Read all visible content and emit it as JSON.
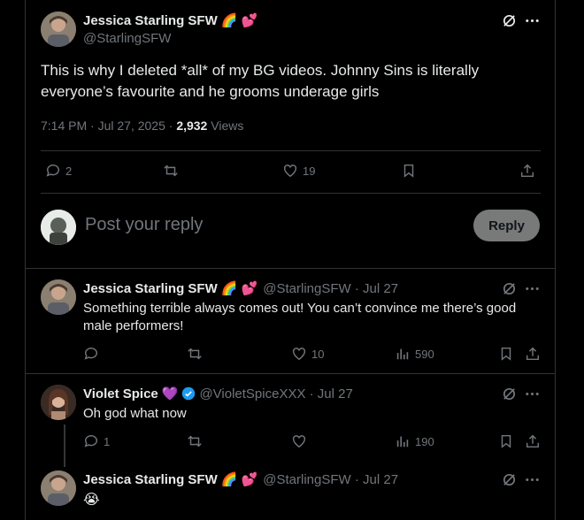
{
  "main_post": {
    "author_name": "Jessica Starling SFW",
    "author_emoji": "🌈 💕",
    "handle": "@StarlingSFW",
    "text_line1": "This is why I deleted *all* of my BG videos. Johnny Sins is literally",
    "text_line2": "everyone’s favourite and he grooms underage girls",
    "time": "7:14 PM · Jul 27, 2025 · ",
    "views_count": "2,932",
    "views_label": " Views",
    "replies": "2",
    "likes": "19"
  },
  "reply_box": {
    "placeholder": "Post your reply",
    "button_label": "Reply"
  },
  "replies": [
    {
      "author_name": "Jessica Starling SFW",
      "author_emoji": "🌈 💕",
      "handle_date": "@StarlingSFW · Jul 27",
      "text_line1": "Something terrible always comes out! You can’t convince me there’s good",
      "text_line2": "male performers!",
      "replies": "",
      "likes": "10",
      "views": "590"
    },
    {
      "author_name": "Violet Spice",
      "author_emoji": "💜",
      "handle_date": "@VioletSpiceXXX · Jul 27",
      "text_line1": "Oh god what now",
      "replies": "1",
      "likes": "",
      "views": "190"
    },
    {
      "author_name": "Jessica Starling SFW",
      "author_emoji": "🌈 💕",
      "handle_date": "@StarlingSFW · Jul 27",
      "text_line1": "😭"
    }
  ],
  "colors": {
    "background": "#000000",
    "text": "#e7e9ea",
    "muted": "#71767b",
    "border": "#2f3336",
    "verified": "#1d9bf0",
    "reply_button_bg": "#787a7a"
  }
}
